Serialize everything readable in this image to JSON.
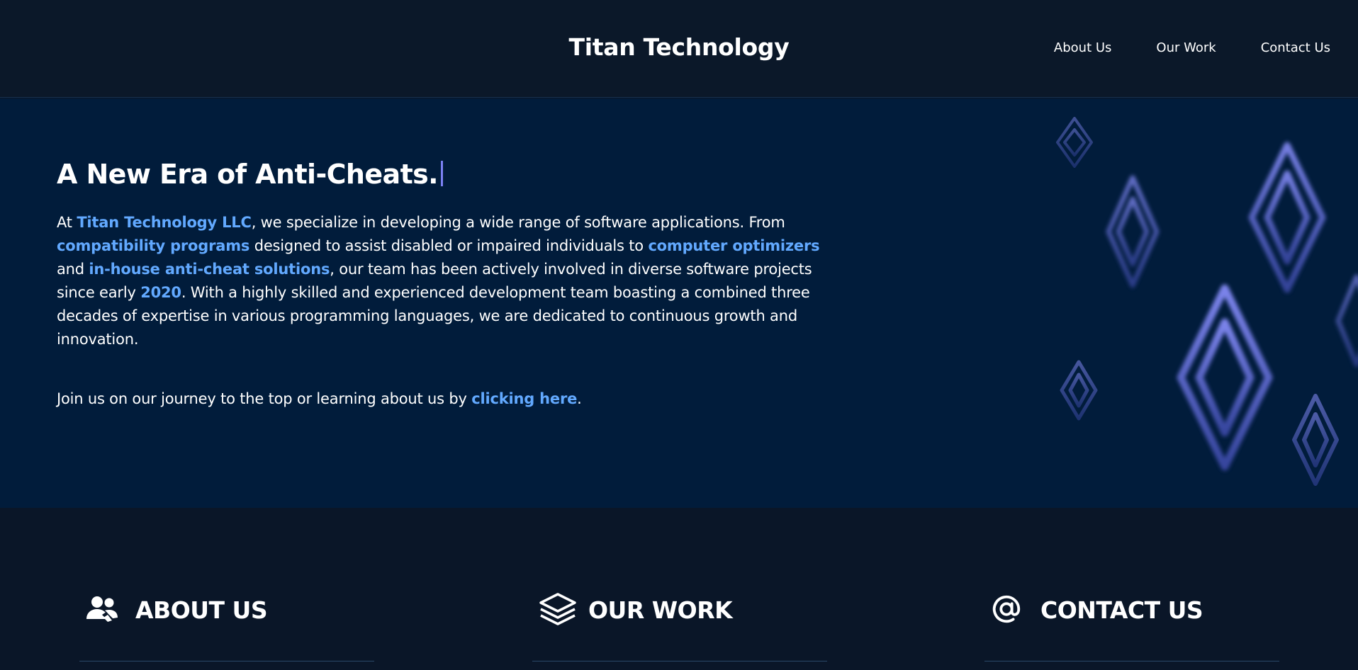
{
  "header": {
    "brand": "Titan Technology",
    "nav": [
      "About Us",
      "Our Work",
      "Contact Us"
    ]
  },
  "hero": {
    "title": "A New Era of Anti-Cheats.",
    "intro": {
      "t1": "At ",
      "company": "Titan Technology LLC",
      "t2": ", we specialize in developing a wide range of software applications. From ",
      "compat": "compatibility programs",
      "t3": " designed to assist disabled or impaired individuals to ",
      "optimizers": "computer optimizers",
      "t4": " and ",
      "anticheat": "in-house anti-cheat solutions",
      "t5": ", our team has been actively involved in diverse software projects since early ",
      "year": "2020",
      "t6": ". With a highly skilled and experienced development team boasting a combined three decades of expertise in various programming languages, we are dedicated to continuous growth and innovation."
    },
    "join": {
      "text": "Join us on our journey to the top or learning about us by ",
      "link": "clicking here",
      "end": "."
    }
  },
  "features": [
    {
      "label": "ABOUT US",
      "icon": "users-icon"
    },
    {
      "label": "OUR WORK",
      "icon": "layers-icon"
    },
    {
      "label": "CONTACT US",
      "icon": "at-sign-icon"
    }
  ],
  "colors": {
    "header_bg": "#0b1829",
    "hero_bg": "#011c3b",
    "accent": "#62a9ff",
    "cursor": "#7b80f2",
    "logo_shape": "#4a5cc8"
  }
}
